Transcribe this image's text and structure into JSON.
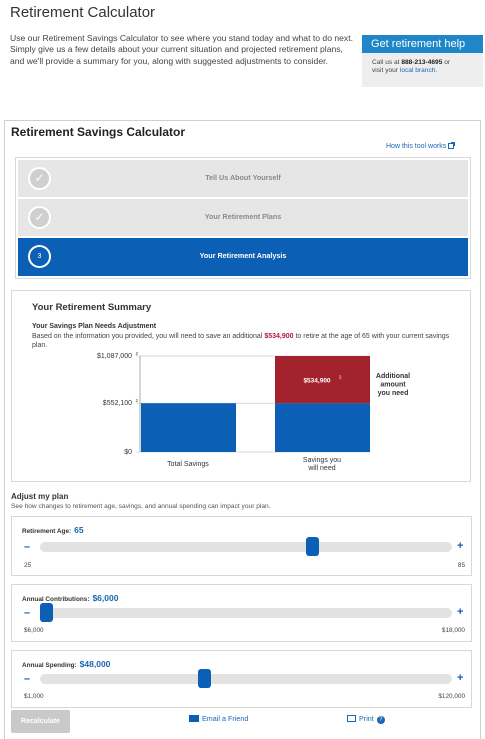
{
  "header": {
    "title": "Retirement Calculator",
    "intro": "Use our Retirement Savings Calculator to see where you stand today and what to do next. Simply give us a few details about your current situation and projected retirement plans, and we'll provide a summary for you, along with suggested adjustments to consider."
  },
  "help": {
    "title": "Get retirement help",
    "call_prefix": "Call us at ",
    "phone": "888-213-4695",
    "call_suffix": " or",
    "visit_prefix": "visit your ",
    "branch_link": "local branch",
    "visit_suffix": "."
  },
  "calculator": {
    "title": "Retirement Savings Calculator",
    "how_link": "How this tool works"
  },
  "steps": [
    {
      "number": "✓",
      "label": "Tell Us About Yourself",
      "state": "complete"
    },
    {
      "number": "✓",
      "label": "Your Retirement Plans",
      "state": "complete"
    },
    {
      "number": "3",
      "label": "Your Retirement Analysis",
      "state": "active"
    }
  ],
  "summary": {
    "title": "Your Retirement Summary",
    "needs_title": "Your Savings Plan Needs Adjustment",
    "needs_pre": "Based on the information you provided, you will need to save an additional ",
    "needs_amount": "$534,900",
    "needs_post": " to retire at the age of 65 with your current savings plan."
  },
  "chart_data": {
    "type": "bar",
    "stacked": true,
    "categories": [
      "Total Savings",
      "Savings you will need"
    ],
    "series": [
      {
        "values": [
          552100,
          552100
        ],
        "color": "#0b5fb4"
      },
      {
        "values": [
          0,
          534900
        ],
        "color": "#a3232d"
      }
    ],
    "ytick_labels": [
      "$0",
      "$552,100",
      "$1,087,000"
    ],
    "ytick_values": [
      0,
      552100,
      1087000
    ],
    "ytick_sup": "2",
    "ylim": [
      0,
      1087000
    ],
    "bar_label": "$534,900",
    "bar_label_sup": "2",
    "annotation": [
      "Additional",
      "amount",
      "you need"
    ],
    "xlabel_1": "Total Savings",
    "xlabel_2_line1": "Savings you",
    "xlabel_2_line2": "will need",
    "colors": {
      "blue": "#0b5fb4",
      "red": "#a3232d"
    }
  },
  "adjust": {
    "title": "Adjust my plan",
    "subtitle": "See how changes to retirement age, savings, and annual spending can impact your plan."
  },
  "sliders": [
    {
      "label": "Retirement Age:",
      "value": "65",
      "min": "25",
      "max": "85",
      "fraction": 0.667
    },
    {
      "label": "Annual Contributions:",
      "value": "$6,000",
      "min": "$6,000",
      "max": "$18,000",
      "fraction": 0.0
    },
    {
      "label": "Annual Spending:",
      "value": "$48,000",
      "min": "$1,000",
      "max": "$120,000",
      "fraction": 0.395
    }
  ],
  "actions": {
    "recalculate": "Recalculate",
    "email": "Email a Friend",
    "print": "Print",
    "help_glyph": "?",
    "minus": "–",
    "plus": "+"
  }
}
